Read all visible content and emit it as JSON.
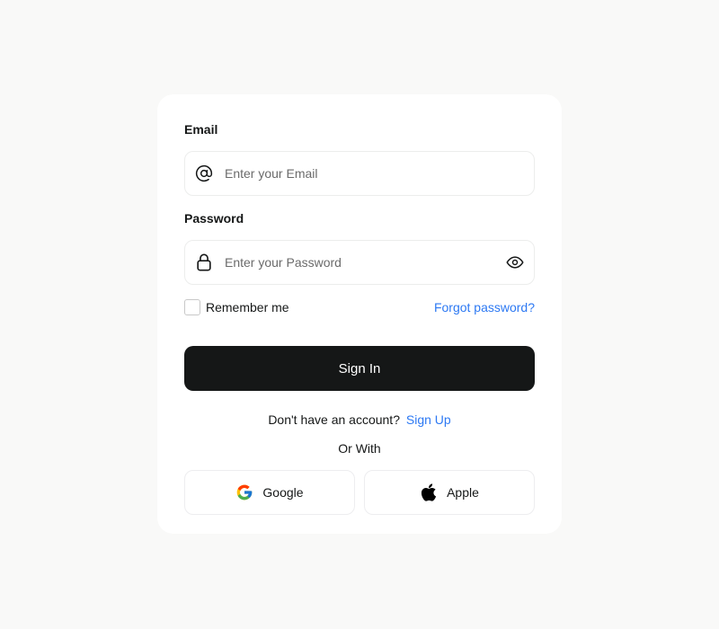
{
  "form": {
    "email_label": "Email",
    "email_placeholder": "Enter your Email",
    "password_label": "Password",
    "password_placeholder": "Enter your Password",
    "remember_label": "Remember me",
    "forgot_label": "Forgot password?",
    "signin_label": "Sign In",
    "no_account_text": "Don't have an account?",
    "signup_label": "Sign Up",
    "or_with_text": "Or With",
    "google_label": "Google",
    "apple_label": "Apple"
  },
  "icons": {
    "email": "at-sign-icon",
    "password": "lock-icon",
    "reveal": "eye-icon",
    "google": "google-icon",
    "apple": "apple-icon"
  },
  "colors": {
    "accent": "#2d79f3",
    "button_bg": "#151717",
    "card_bg": "#ffffff",
    "page_bg": "#f9f9f8"
  }
}
